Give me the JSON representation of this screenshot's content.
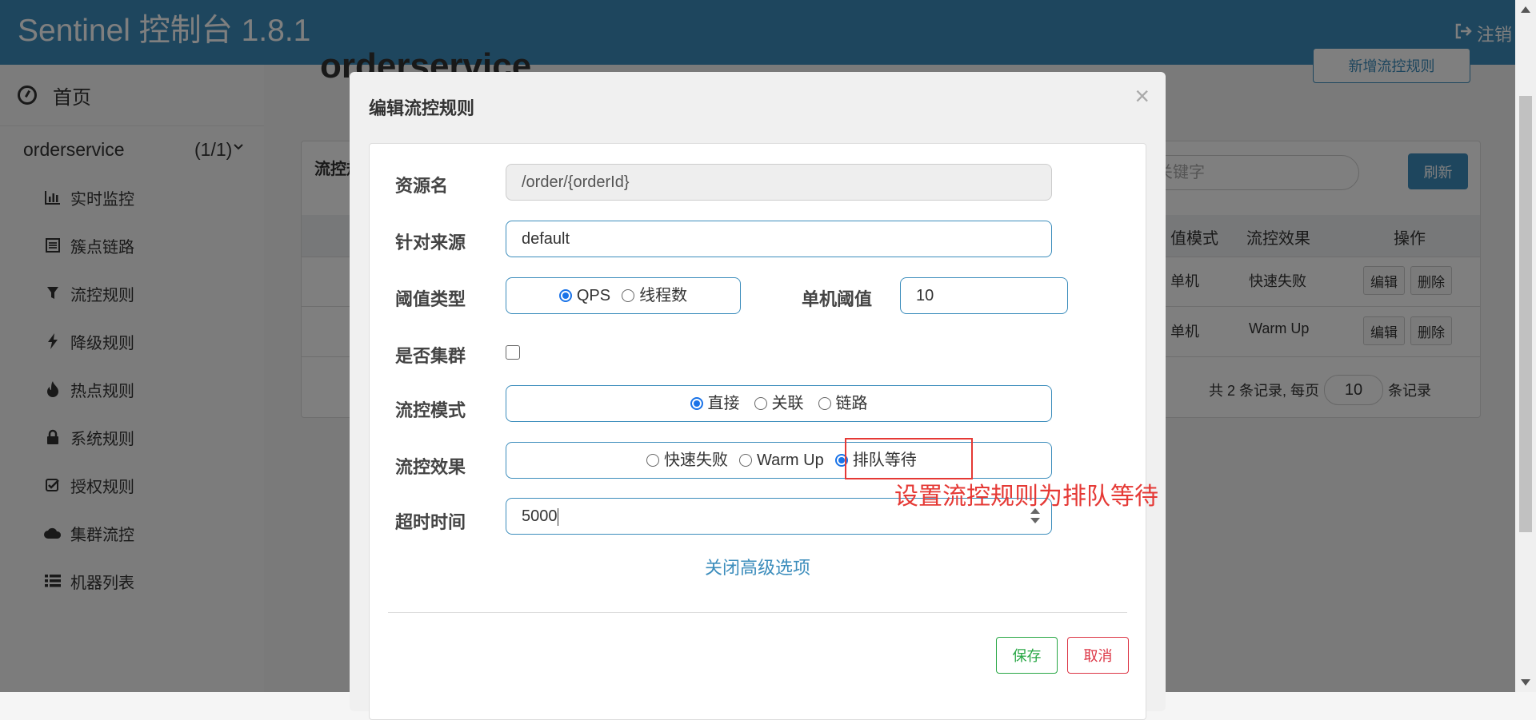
{
  "header": {
    "title": "Sentinel 控制台 1.8.1",
    "logout_label": "注销"
  },
  "sidebar": {
    "home_label": "首页",
    "app": {
      "name": "orderservice",
      "count": "(1/1)"
    },
    "items": [
      {
        "label": "实时监控",
        "icon": "bar-chart-icon"
      },
      {
        "label": "簇点链路",
        "icon": "list-icon"
      },
      {
        "label": "流控规则",
        "icon": "filter-icon"
      },
      {
        "label": "降级规则",
        "icon": "bolt-icon"
      },
      {
        "label": "热点规则",
        "icon": "fire-icon"
      },
      {
        "label": "系统规则",
        "icon": "lock-icon"
      },
      {
        "label": "授权规则",
        "icon": "check-square-icon"
      },
      {
        "label": "集群流控",
        "icon": "cloud-icon"
      },
      {
        "label": "机器列表",
        "icon": "list-ul-icon"
      }
    ]
  },
  "background": {
    "title": "orderservice",
    "new_button": "新增流控规则",
    "panel_title": "流控规",
    "search_placeholder": "关键字",
    "refresh_label": "刷新",
    "columns": [
      "值模式",
      "流控效果",
      "操作"
    ],
    "rows": [
      {
        "mode": "单机",
        "effect": "快速失败"
      },
      {
        "mode": "单机",
        "effect": "Warm Up"
      }
    ],
    "edit_label": "编辑",
    "delete_label": "删除",
    "pager": {
      "prefix": "共 2 条记录, 每页",
      "page_size": "10",
      "suffix": "条记录"
    }
  },
  "modal": {
    "title": "编辑流控规则",
    "close_symbol": "×",
    "resource": {
      "label": "资源名",
      "value": "/order/{orderId}"
    },
    "source": {
      "label": "针对来源",
      "value": "default"
    },
    "threshold_type": {
      "label": "阈值类型",
      "options": [
        "QPS",
        "线程数"
      ],
      "selected": "QPS"
    },
    "single_threshold": {
      "label": "单机阈值",
      "value": "10"
    },
    "cluster": {
      "label": "是否集群",
      "checked": false
    },
    "flow_mode": {
      "label": "流控模式",
      "options": [
        "直接",
        "关联",
        "链路"
      ],
      "selected": "直接"
    },
    "flow_effect": {
      "label": "流控效果",
      "options": [
        "快速失败",
        "Warm Up",
        "排队等待"
      ],
      "selected": "排队等待"
    },
    "timeout": {
      "label": "超时时间",
      "value": "5000"
    },
    "advanced_link": "关闭高级选项",
    "save_label": "保存",
    "cancel_label": "取消"
  },
  "annotation": {
    "text": "设置流控规则为排队等待",
    "color": "#e53935"
  },
  "colors": {
    "brand": "#3c8dbc",
    "save": "#28a745",
    "cancel": "#dc3545"
  }
}
